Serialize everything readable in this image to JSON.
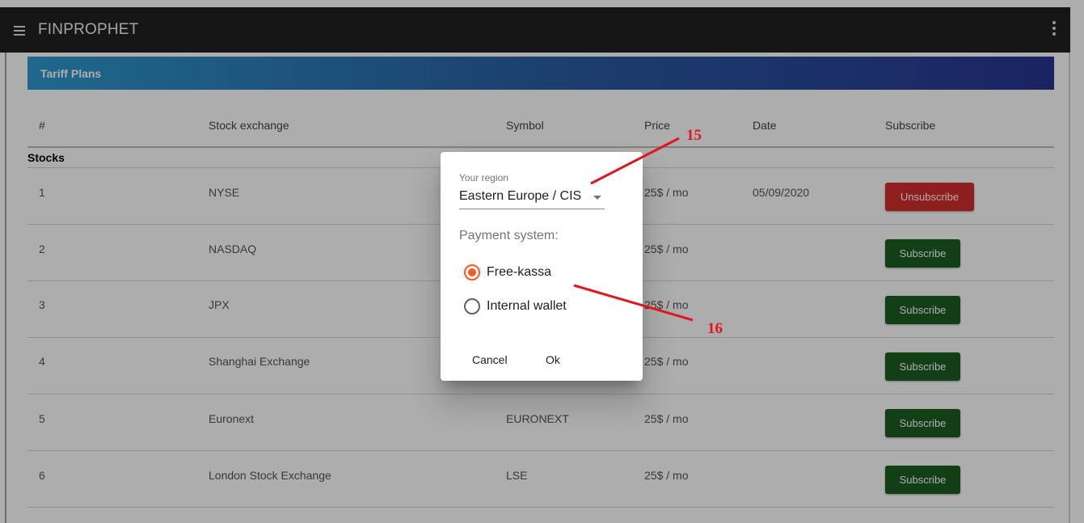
{
  "app": {
    "title": "FINPROPHET"
  },
  "section": {
    "title": "Tariff Plans"
  },
  "table": {
    "headers": [
      "#",
      "Stock exchange",
      "Symbol",
      "Price",
      "Date",
      "Subscribe"
    ],
    "group": "Stocks",
    "rows": [
      {
        "num": "1",
        "exchange": "NYSE",
        "symbol": "",
        "price": "25$ / mo",
        "date": "05/09/2020",
        "action": "Unsubscribe"
      },
      {
        "num": "2",
        "exchange": "NASDAQ",
        "symbol": "",
        "price": "25$ / mo",
        "date": "",
        "action": "Subscribe"
      },
      {
        "num": "3",
        "exchange": "JPX",
        "symbol": "",
        "price": "25$ / mo",
        "date": "",
        "action": "Subscribe"
      },
      {
        "num": "4",
        "exchange": "Shanghai Exchange",
        "symbol": "",
        "price": "25$ / mo",
        "date": "",
        "action": "Subscribe"
      },
      {
        "num": "5",
        "exchange": "Euronext",
        "symbol": "EURONEXT",
        "price": "25$ / mo",
        "date": "",
        "action": "Subscribe"
      },
      {
        "num": "6",
        "exchange": "London Stock Exchange",
        "symbol": "LSE",
        "price": "25$ / mo",
        "date": "",
        "action": "Subscribe"
      }
    ]
  },
  "dialog": {
    "region_label": "Your region",
    "region_value": "Eastern Europe / CIS",
    "payment_label": "Payment system:",
    "options": [
      {
        "label": "Free-kassa",
        "checked": true
      },
      {
        "label": "Internal wallet",
        "checked": false
      }
    ],
    "cancel": "Cancel",
    "ok": "Ok"
  },
  "annotations": {
    "a15": "15",
    "a16": "16",
    "color": "#e0171f"
  },
  "colors": {
    "subscribe": "#1b5e20",
    "unsubscribe": "#d32f2f",
    "radio_accent": "#ff5722",
    "appbar": "#212121"
  }
}
